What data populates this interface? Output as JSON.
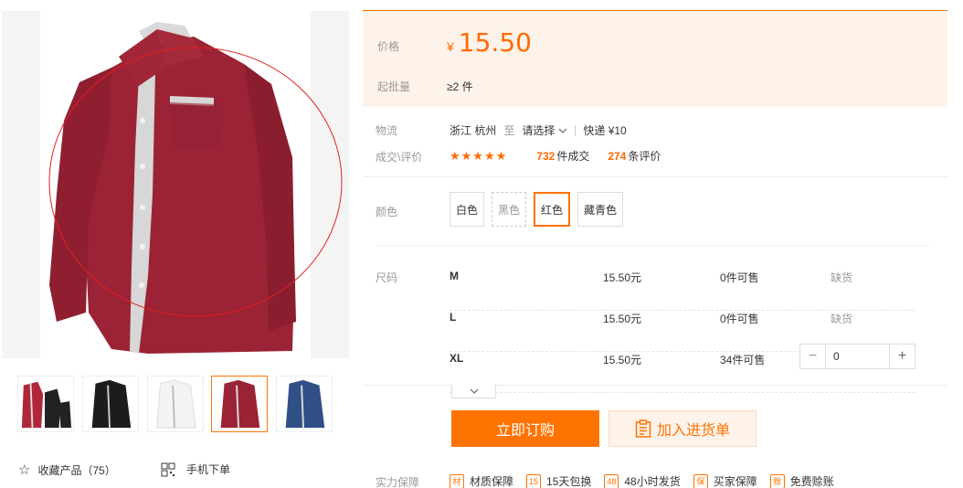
{
  "gallery": {
    "thumbnails": [
      {
        "color": "red-assortment"
      },
      {
        "color": "black"
      },
      {
        "color": "white"
      },
      {
        "color": "wine-red",
        "active": true
      },
      {
        "color": "navy"
      }
    ],
    "favorite_label": "收藏产品（75）",
    "mobile_order_label": "手机下单"
  },
  "price": {
    "label": "价格",
    "currency": "¥",
    "value": "15.50",
    "moq_label": "起批量",
    "moq_value": "≥2 件"
  },
  "logistics": {
    "label": "物流",
    "origin": "浙江 杭州",
    "to": "至",
    "destination": "请选择",
    "shipping": "快递 ¥10"
  },
  "deals": {
    "label": "成交\\评价",
    "stars": "★★★★★",
    "sold_count": "732",
    "sold_unit": "件成交",
    "review_count": "274",
    "review_unit": "条评价"
  },
  "color": {
    "label": "颜色",
    "options": [
      "白色",
      "黑色",
      "红色",
      "藏青色"
    ],
    "selected": "红色"
  },
  "size": {
    "label": "尺码",
    "rows": [
      {
        "name": "M",
        "price": "15.50元",
        "stock": "0件可售",
        "status": "缺货"
      },
      {
        "name": "L",
        "price": "15.50元",
        "stock": "0件可售",
        "status": "缺货"
      },
      {
        "name": "XL",
        "price": "15.50元",
        "stock": "34件可售",
        "quantity": "0"
      }
    ]
  },
  "actions": {
    "buy_now": "立即订购",
    "add_to_cart": "加入进货单"
  },
  "guarantee": {
    "label": "实力保障",
    "items": [
      {
        "icon": "材",
        "label": "材质保障"
      },
      {
        "icon": "15",
        "label": "15天包换"
      },
      {
        "icon": "48",
        "label": "48小时发货"
      },
      {
        "icon": "保",
        "label": "买家保障"
      },
      {
        "icon": "赊",
        "label": "免费赊账"
      }
    ]
  },
  "colors": {
    "accent": "#ff7300",
    "price": "#ff6a00",
    "price_bg": "#fdf3ea",
    "shirt_main": "#9b2335"
  }
}
